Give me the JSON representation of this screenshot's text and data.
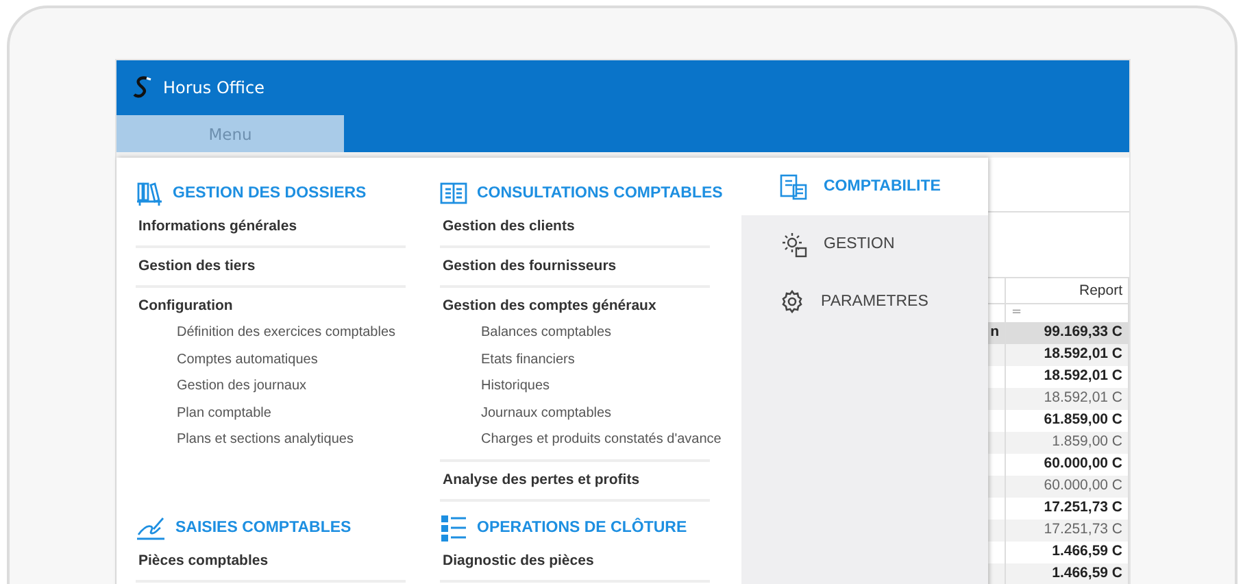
{
  "window": {
    "title": "Horus Office"
  },
  "menu_tab": {
    "label": "Menu",
    "selected": true
  },
  "sections": [
    {
      "title": "GESTION DES DOSSIERS",
      "items": [
        {
          "label": "Informations générales"
        },
        {
          "label": "Gestion des tiers"
        },
        {
          "label": "Configuration",
          "children": [
            "Définition des exercices comptables",
            "Comptes automatiques",
            "Gestion des journaux",
            "Plan comptable",
            "Plans et sections analytiques"
          ]
        }
      ]
    },
    {
      "title": "CONSULTATIONS COMPTABLES",
      "items": [
        {
          "label": "Gestion des clients"
        },
        {
          "label": "Gestion des fournisseurs"
        },
        {
          "label": "Gestion des comptes généraux",
          "children": [
            "Balances comptables",
            "Etats financiers",
            "Historiques",
            "Journaux comptables",
            "Charges et produits constatés d'avance"
          ]
        },
        {
          "label": "Analyse des pertes et profits"
        }
      ]
    },
    {
      "title": "SAISIES COMPTABLES",
      "items": [
        {
          "label": "Pièces comptables"
        }
      ]
    },
    {
      "title": "OPERATIONS DE CLÔTURE",
      "items": [
        {
          "label": "Diagnostic des pièces"
        }
      ]
    }
  ],
  "categories": [
    {
      "label": "COMPTABILITE",
      "selected": true
    },
    {
      "label": "GESTION",
      "selected": false
    },
    {
      "label": "PARAMETRES",
      "selected": false
    }
  ],
  "table": {
    "column_2": "Report",
    "filter": "=",
    "rows": [
      {
        "column_1": "n",
        "report": "99.169,33 C",
        "bold": true,
        "selected": true
      },
      {
        "report": "18.592,01 C",
        "bold": true,
        "selected": false
      },
      {
        "report": "18.592,01 C",
        "bold": true,
        "selected": false
      },
      {
        "report": "18.592,01 C",
        "bold": false,
        "selected": false
      },
      {
        "report": "61.859,00 C",
        "bold": true,
        "selected": false
      },
      {
        "report": "1.859,00 C",
        "bold": false,
        "selected": false
      },
      {
        "report": "60.000,00 C",
        "bold": true,
        "selected": false
      },
      {
        "report": "60.000,00 C",
        "bold": false,
        "selected": false
      },
      {
        "report": "17.251,73 C",
        "bold": true,
        "selected": false
      },
      {
        "report": "17.251,73 C",
        "bold": false,
        "selected": false
      },
      {
        "report": "1.466,59 C",
        "bold": true,
        "selected": false
      },
      {
        "report": "1.466,59 C",
        "bold": true,
        "selected": false
      }
    ]
  }
}
